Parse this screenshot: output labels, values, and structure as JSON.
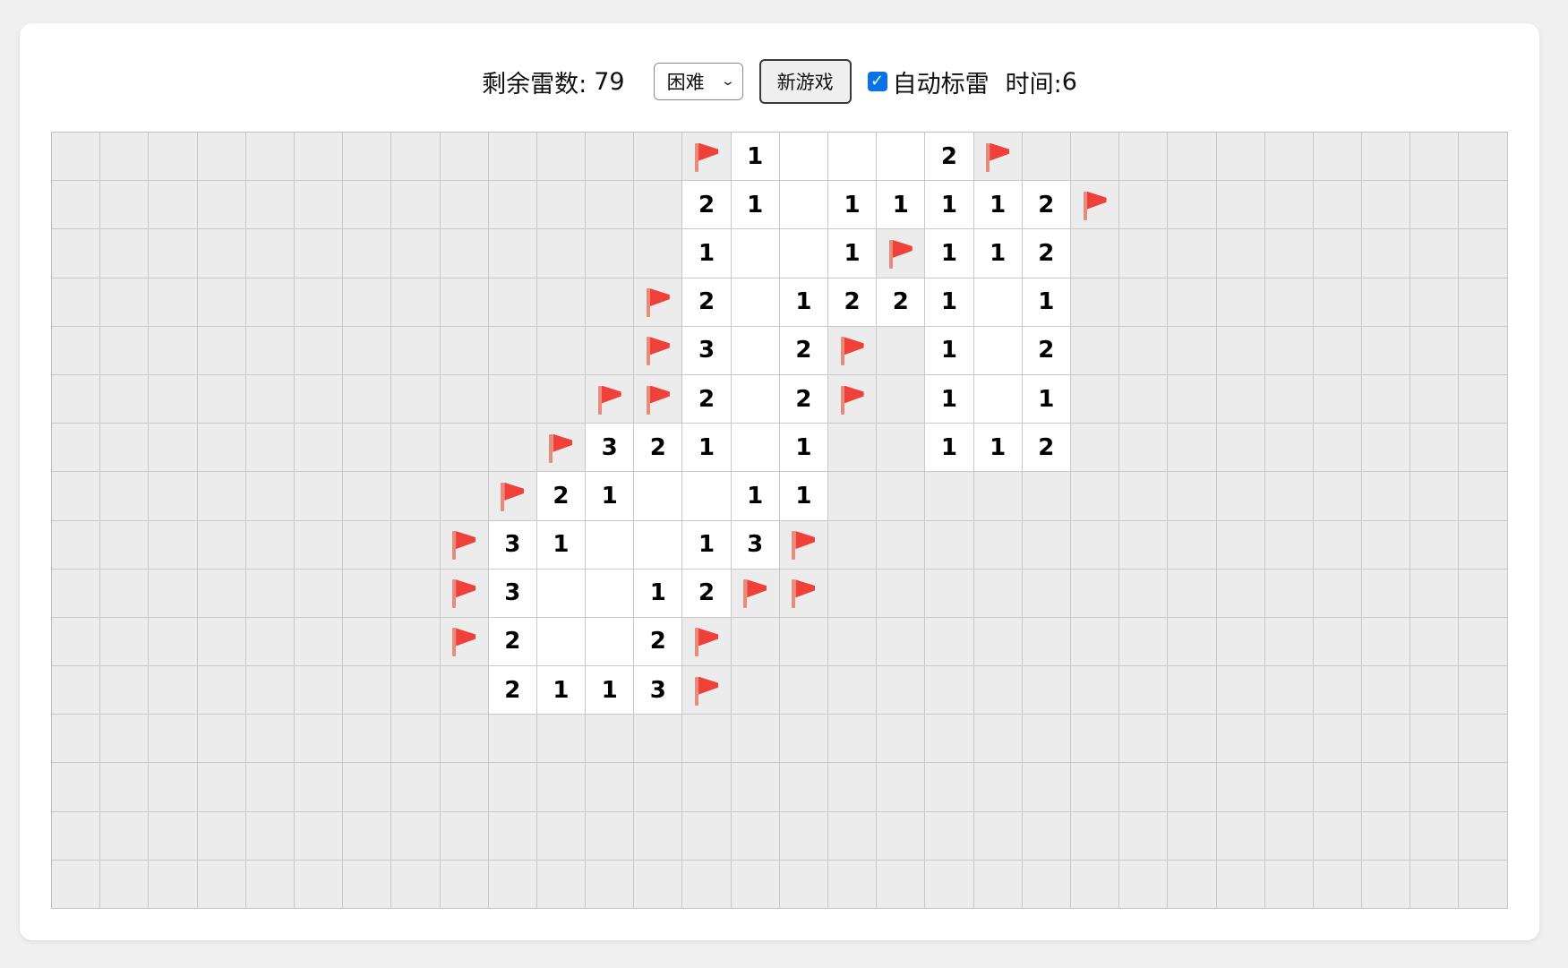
{
  "toolbar": {
    "mines_label": "剩余雷数:",
    "mines_remaining": "79",
    "difficulty": "困难",
    "new_game_label": "新游戏",
    "auto_flag_checked": true,
    "auto_flag_label": "自动标雷",
    "time_label": "时间:",
    "time_value": "6"
  },
  "board": {
    "rows": 16,
    "cols": 30,
    "legend": {
      "#": "unopened",
      "F": "flag",
      ".": "opened empty",
      "1-8": "opened number"
    },
    "cells": [
      "#############F1...2F##########",
      "#############21.11112F##########",
      "#############1..1F112##########",
      "############F2.1221.1##########",
      "############F3.2F#1.2##########",
      "###########FF2.2F#1.1##########",
      "##########F321.1##112##########",
      "#########F21..11##############",
      "########F31..13F##############",
      "########F3..12FF##############",
      "########F2..2F################",
      "#########2113F################",
      "##############################",
      "##############################",
      "##############################",
      "##############################"
    ]
  },
  "colors": {
    "unopened": "#ececec",
    "opened": "#ffffff",
    "grid_line": "#c8c8c8",
    "flag": "#ef3a36",
    "flag_pole": "#e88b7a",
    "checkbox": "#0b72e7",
    "background": "#f0f0f0"
  },
  "icons": {
    "flag": "red-flag-icon",
    "checkbox": "checkmark-icon",
    "select": "chevron-down-icon"
  }
}
